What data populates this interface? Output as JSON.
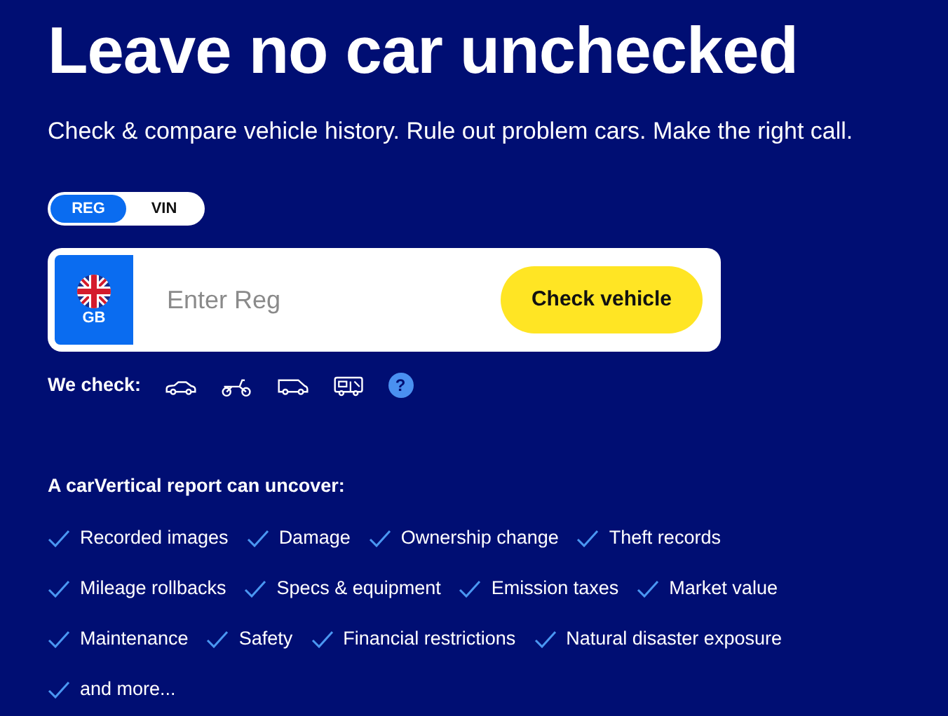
{
  "title": "Leave no car unchecked",
  "subtitle": "Check & compare vehicle history. Rule out problem cars. Make the right call.",
  "mode_tabs": [
    {
      "label": "REG",
      "selected": true
    },
    {
      "label": "VIN",
      "selected": false
    }
  ],
  "search": {
    "country": "GB",
    "placeholder": "Enter Reg",
    "button": "Check vehicle"
  },
  "we_check": {
    "label": "We check:",
    "vehicles": [
      {
        "kind": "car"
      },
      {
        "kind": "motorcycle"
      },
      {
        "kind": "van"
      },
      {
        "kind": "camper"
      }
    ],
    "help": "?"
  },
  "report": {
    "heading": "A carVertical report can uncover:",
    "rows": [
      [
        "Recorded images",
        "Damage",
        "Ownership change",
        "Theft records"
      ],
      [
        "Mileage rollbacks",
        "Specs & equipment",
        "Emission taxes",
        "Market value"
      ],
      [
        "Maintenance",
        "Safety",
        "Financial restrictions",
        "Natural disaster exposure"
      ],
      [
        "and more..."
      ]
    ]
  }
}
